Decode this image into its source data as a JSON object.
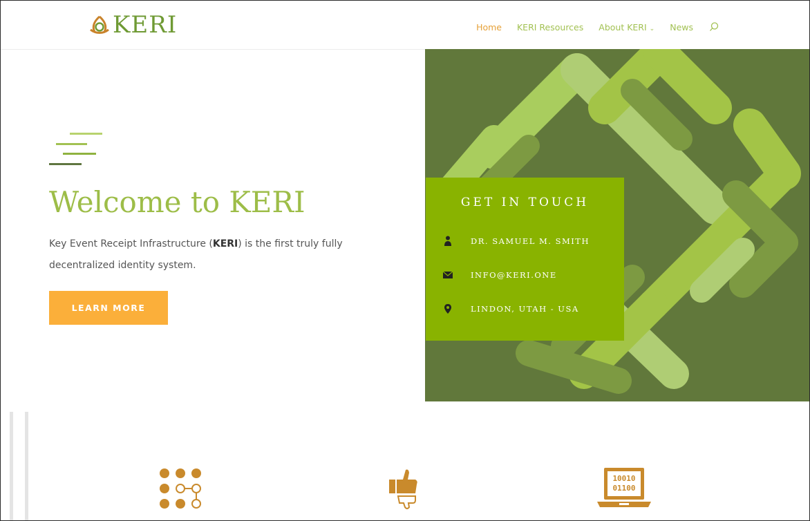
{
  "brand": {
    "name": "KERI"
  },
  "nav": {
    "items": [
      {
        "label": "Home",
        "active": true
      },
      {
        "label": "KERI Resources",
        "active": false
      },
      {
        "label": "About KERI",
        "active": false,
        "has_dropdown": true
      },
      {
        "label": "News",
        "active": false
      }
    ],
    "search_icon": "search-icon"
  },
  "hero": {
    "title": "Welcome to KERI",
    "description_before": "Key Event Receipt Infrastructure (",
    "description_bold": "KERI",
    "description_after": ") is the first truly fully decentralized identity system.",
    "button_label": "LEARN MORE"
  },
  "contact": {
    "title": "GET IN TOUCH",
    "rows": [
      {
        "icon": "person-icon",
        "text": "DR. SAMUEL M. SMITH"
      },
      {
        "icon": "envelope-icon",
        "text": "INFO@KERI.ONE"
      },
      {
        "icon": "location-pin-icon",
        "text": "LINDON, UTAH - USA"
      }
    ]
  },
  "features": {
    "icons": [
      {
        "name": "dot-grid-network-icon"
      },
      {
        "name": "thumbs-up-down-icon"
      },
      {
        "name": "binary-laptop-icon",
        "binary_lines": [
          "10010",
          "01100"
        ]
      }
    ]
  },
  "colors": {
    "accent_green": "#9dbd48",
    "dark_green": "#61783b",
    "contact_green": "#89b300",
    "orange": "#fbaf3a",
    "icon_orange": "#c98a2c"
  }
}
